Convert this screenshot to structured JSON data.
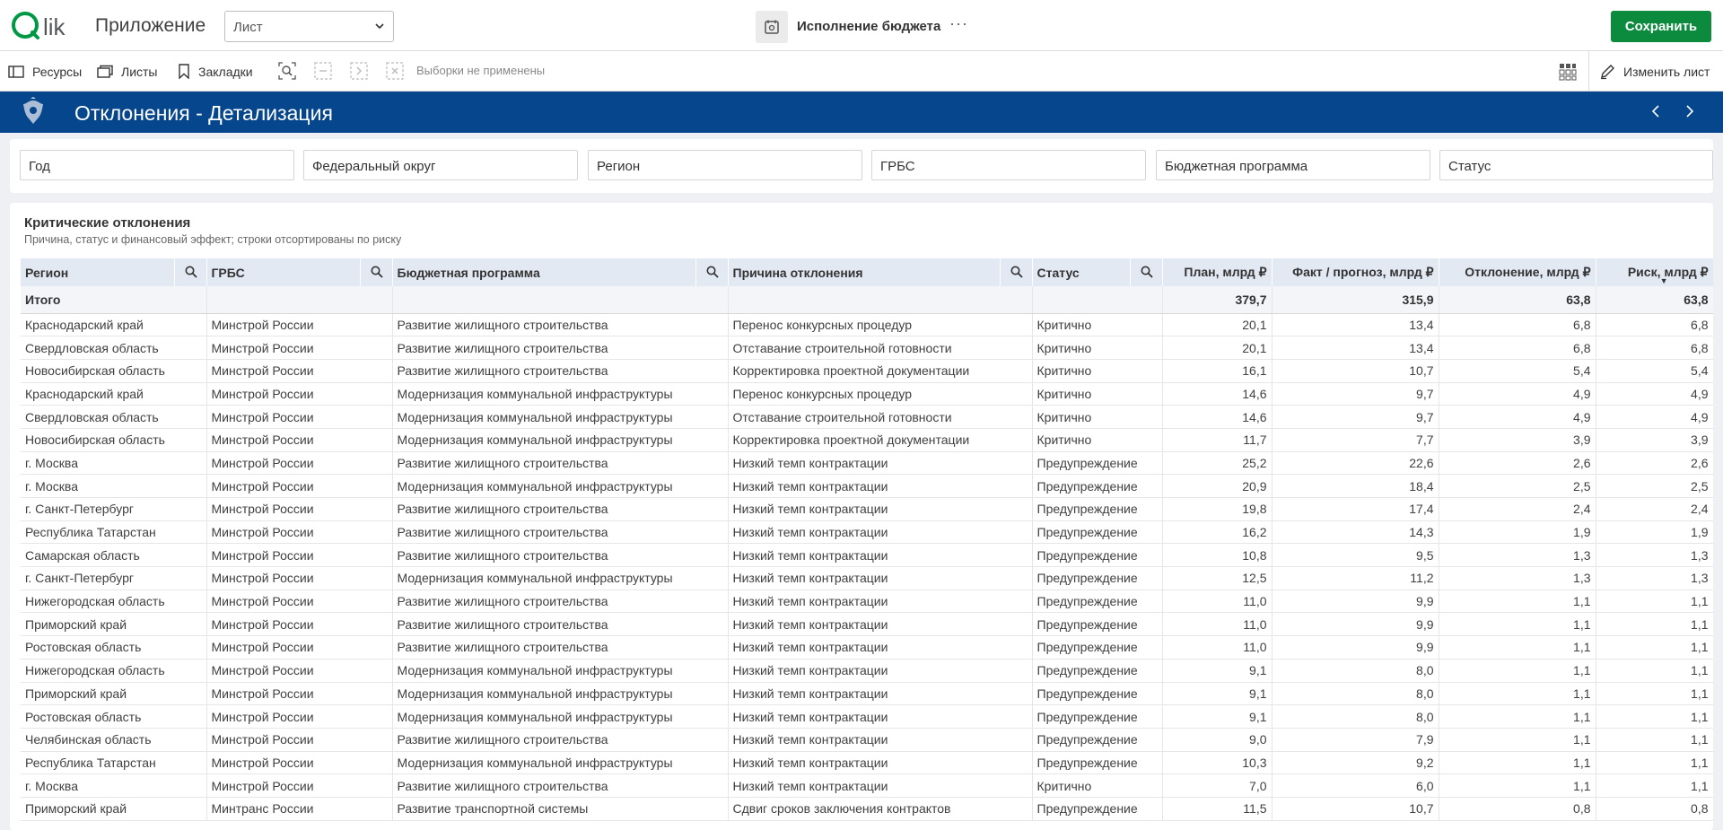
{
  "header": {
    "logo_text": "Qlik",
    "app_title": "Приложение",
    "sheet_select_value": "Лист",
    "app_name": "Исполнение бюджета",
    "more_label": "···",
    "save_label": "Сохранить"
  },
  "toolbar": {
    "resources": "Ресурсы",
    "sheets": "Листы",
    "bookmarks": "Закладки",
    "no_selections": "Выборки не применены",
    "edit_sheet": "Изменить лист"
  },
  "sheet": {
    "title": "Отклонения - Детализация"
  },
  "filters": [
    "Год",
    "Федеральный округ",
    "Регион",
    "ГРБС",
    "Бюджетная программа",
    "Статус"
  ],
  "table": {
    "title": "Критические отклонения",
    "subtitle": "Причина, статус и финансовый эффект; строки отсортированы по риску",
    "columns": [
      "Регион",
      "ГРБС",
      "Бюджетная программа",
      "Причина отклонения",
      "Статус",
      "План, млрд ₽",
      "Факт / прогноз, млрд ₽",
      "Отклонение, млрд ₽",
      "Риск, млрд ₽"
    ],
    "total": [
      "Итого",
      "",
      "",
      "",
      "",
      "379,7",
      "315,9",
      "63,8",
      "63,8"
    ],
    "rows": [
      [
        "Краснодарский край",
        "Минстрой России",
        "Развитие жилищного строительства",
        "Перенос конкурсных процедур",
        "Критично",
        "20,1",
        "13,4",
        "6,8",
        "6,8"
      ],
      [
        "Свердловская область",
        "Минстрой России",
        "Развитие жилищного строительства",
        "Отставание строительной готовности",
        "Критично",
        "20,1",
        "13,4",
        "6,8",
        "6,8"
      ],
      [
        "Новосибирская область",
        "Минстрой России",
        "Развитие жилищного строительства",
        "Корректировка проектной документации",
        "Критично",
        "16,1",
        "10,7",
        "5,4",
        "5,4"
      ],
      [
        "Краснодарский край",
        "Минстрой России",
        "Модернизация коммунальной инфраструктуры",
        "Перенос конкурсных процедур",
        "Критично",
        "14,6",
        "9,7",
        "4,9",
        "4,9"
      ],
      [
        "Свердловская область",
        "Минстрой России",
        "Модернизация коммунальной инфраструктуры",
        "Отставание строительной готовности",
        "Критично",
        "14,6",
        "9,7",
        "4,9",
        "4,9"
      ],
      [
        "Новосибирская область",
        "Минстрой России",
        "Модернизация коммунальной инфраструктуры",
        "Корректировка проектной документации",
        "Критично",
        "11,7",
        "7,7",
        "3,9",
        "3,9"
      ],
      [
        "г. Москва",
        "Минстрой России",
        "Развитие жилищного строительства",
        "Низкий темп контрактации",
        "Предупреждение",
        "25,2",
        "22,6",
        "2,6",
        "2,6"
      ],
      [
        "г. Москва",
        "Минстрой России",
        "Модернизация коммунальной инфраструктуры",
        "Низкий темп контрактации",
        "Предупреждение",
        "20,9",
        "18,4",
        "2,5",
        "2,5"
      ],
      [
        "г. Санкт-Петербург",
        "Минстрой России",
        "Развитие жилищного строительства",
        "Низкий темп контрактации",
        "Предупреждение",
        "19,8",
        "17,4",
        "2,4",
        "2,4"
      ],
      [
        "Республика Татарстан",
        "Минстрой России",
        "Развитие жилищного строительства",
        "Низкий темп контрактации",
        "Предупреждение",
        "16,2",
        "14,3",
        "1,9",
        "1,9"
      ],
      [
        "Самарская область",
        "Минстрой России",
        "Развитие жилищного строительства",
        "Низкий темп контрактации",
        "Предупреждение",
        "10,8",
        "9,5",
        "1,3",
        "1,3"
      ],
      [
        "г. Санкт-Петербург",
        "Минстрой России",
        "Модернизация коммунальной инфраструктуры",
        "Низкий темп контрактации",
        "Предупреждение",
        "12,5",
        "11,2",
        "1,3",
        "1,3"
      ],
      [
        "Нижегородская область",
        "Минстрой России",
        "Развитие жилищного строительства",
        "Низкий темп контрактации",
        "Предупреждение",
        "11,0",
        "9,9",
        "1,1",
        "1,1"
      ],
      [
        "Приморский край",
        "Минстрой России",
        "Развитие жилищного строительства",
        "Низкий темп контрактации",
        "Предупреждение",
        "11,0",
        "9,9",
        "1,1",
        "1,1"
      ],
      [
        "Ростовская область",
        "Минстрой России",
        "Развитие жилищного строительства",
        "Низкий темп контрактации",
        "Предупреждение",
        "11,0",
        "9,9",
        "1,1",
        "1,1"
      ],
      [
        "Нижегородская область",
        "Минстрой России",
        "Модернизация коммунальной инфраструктуры",
        "Низкий темп контрактации",
        "Предупреждение",
        "9,1",
        "8,0",
        "1,1",
        "1,1"
      ],
      [
        "Приморский край",
        "Минстрой России",
        "Модернизация коммунальной инфраструктуры",
        "Низкий темп контрактации",
        "Предупреждение",
        "9,1",
        "8,0",
        "1,1",
        "1,1"
      ],
      [
        "Ростовская область",
        "Минстрой России",
        "Модернизация коммунальной инфраструктуры",
        "Низкий темп контрактации",
        "Предупреждение",
        "9,1",
        "8,0",
        "1,1",
        "1,1"
      ],
      [
        "Челябинская область",
        "Минстрой России",
        "Развитие жилищного строительства",
        "Низкий темп контрактации",
        "Предупреждение",
        "9,0",
        "7,9",
        "1,1",
        "1,1"
      ],
      [
        "Республика Татарстан",
        "Минстрой России",
        "Модернизация коммунальной инфраструктуры",
        "Низкий темп контрактации",
        "Предупреждение",
        "10,3",
        "9,2",
        "1,1",
        "1,1"
      ],
      [
        "г. Москва",
        "Минстрой России",
        "Развитие жилищного строительства",
        "Низкий темп контрактации",
        "Критично",
        "7,0",
        "6,0",
        "1,1",
        "1,1"
      ],
      [
        "Приморский край",
        "Минтранс России",
        "Развитие транспортной системы",
        "Сдвиг сроков заключения контрактов",
        "Предупреждение",
        "11,5",
        "10,7",
        "0,8",
        "0,8"
      ]
    ]
  },
  "colors": {
    "brand_green": "#0c8a3e",
    "sheet_bar": "#06468c",
    "header_row": "#e3e9f3"
  }
}
